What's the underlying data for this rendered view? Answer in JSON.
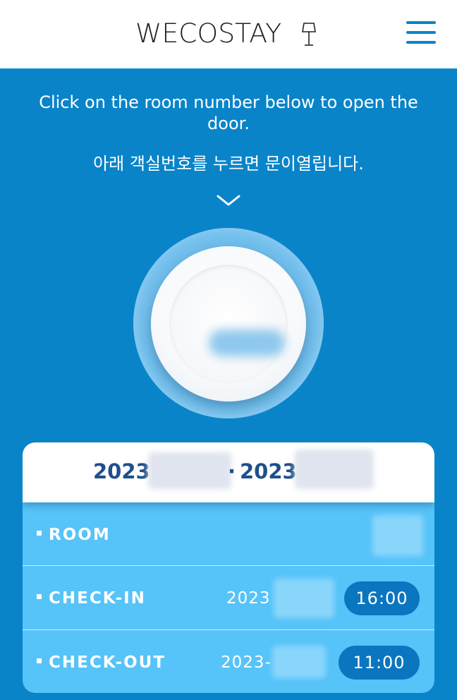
{
  "header": {
    "logo_text": "WECOSTAY",
    "logo_icon": "lamp-icon",
    "menu_icon": "hamburger-menu-icon"
  },
  "instructions": {
    "english": "Click on the room number below to open the door.",
    "korean": "아래 객실번호를 누르면 문이열립니다.",
    "chevron_icon": "chevron-down-icon"
  },
  "door": {
    "room_number": ""
  },
  "stay": {
    "date_start": "2023",
    "date_separator": "·",
    "date_end": "2023",
    "rows": [
      {
        "label": "ROOM",
        "date": "",
        "time": ""
      },
      {
        "label": "CHECK-IN",
        "date": "2023",
        "time": "16:00"
      },
      {
        "label": "CHECK-OUT",
        "date": "2023-",
        "time": "11:00"
      }
    ]
  },
  "colors": {
    "brand_blue": "#0a84c9",
    "card_blue": "#56c3f9",
    "pill_blue": "#0a76bf",
    "date_text": "#1f4f8c"
  }
}
